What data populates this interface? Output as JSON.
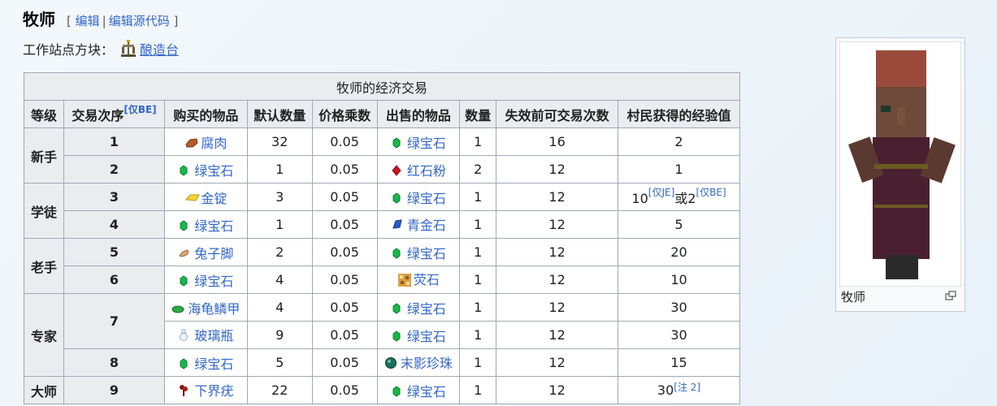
{
  "heading": {
    "title": "牧师",
    "bracket_open": "[",
    "edit": "编辑",
    "separator": "|",
    "edit_source": "编辑源代码",
    "bracket_close": "]"
  },
  "workstation": {
    "label": "工作站点方块：",
    "icon": "brewing-stand-icon",
    "link": "酿造台"
  },
  "table": {
    "caption": "牧师的经济交易",
    "headers": [
      "等级",
      "交易次序",
      "[仅BE]",
      "购买的物品",
      "默认数量",
      "价格乘数",
      "出售的物品",
      "数量",
      "失效前可交易次数",
      "村民获得的经验值"
    ],
    "levels": [
      "新手",
      "学徒",
      "老手",
      "专家",
      "大师"
    ],
    "rows": [
      {
        "order": "1",
        "buy": "腐肉",
        "buy_icon": "rotten-flesh-icon",
        "qty": "32",
        "mult": "0.05",
        "sell": "绿宝石",
        "sell_icon": "emerald-icon",
        "sell_qty": "1",
        "uses": "16",
        "xp": "2"
      },
      {
        "order": "2",
        "buy": "绿宝石",
        "buy_icon": "emerald-icon",
        "qty": "1",
        "mult": "0.05",
        "sell": "红石粉",
        "sell_icon": "redstone-icon",
        "sell_qty": "2",
        "uses": "12",
        "xp": "1"
      },
      {
        "order": "3",
        "buy": "金锭",
        "buy_icon": "gold-ingot-icon",
        "qty": "3",
        "mult": "0.05",
        "sell": "绿宝石",
        "sell_icon": "emerald-icon",
        "sell_qty": "1",
        "uses": "12",
        "xp_a": "10",
        "xp_sup_a": "[仅JE]",
        "xp_or": "或",
        "xp_b": "2",
        "xp_sup_b": "[仅BE]"
      },
      {
        "order": "4",
        "buy": "绿宝石",
        "buy_icon": "emerald-icon",
        "qty": "1",
        "mult": "0.05",
        "sell": "青金石",
        "sell_icon": "lapis-icon",
        "sell_qty": "1",
        "uses": "12",
        "xp": "5"
      },
      {
        "order": "5",
        "buy": "兔子脚",
        "buy_icon": "rabbit-foot-icon",
        "qty": "2",
        "mult": "0.05",
        "sell": "绿宝石",
        "sell_icon": "emerald-icon",
        "sell_qty": "1",
        "uses": "12",
        "xp": "20"
      },
      {
        "order": "6",
        "buy": "绿宝石",
        "buy_icon": "emerald-icon",
        "qty": "4",
        "mult": "0.05",
        "sell": "荧石",
        "sell_icon": "glowstone-icon",
        "sell_qty": "1",
        "uses": "12",
        "xp": "10"
      },
      {
        "order": "7",
        "buy": "海龟鳞甲",
        "buy_icon": "scute-icon",
        "qty": "4",
        "mult": "0.05",
        "sell": "绿宝石",
        "sell_icon": "emerald-icon",
        "sell_qty": "1",
        "uses": "12",
        "xp": "30"
      },
      {
        "buy": "玻璃瓶",
        "buy_icon": "glass-bottle-icon",
        "qty": "9",
        "mult": "0.05",
        "sell": "绿宝石",
        "sell_icon": "emerald-icon",
        "sell_qty": "1",
        "uses": "12",
        "xp": "30"
      },
      {
        "order": "8",
        "buy": "绿宝石",
        "buy_icon": "emerald-icon",
        "qty": "5",
        "mult": "0.05",
        "sell": "末影珍珠",
        "sell_icon": "ender-pearl-icon",
        "sell_qty": "1",
        "uses": "12",
        "xp": "15"
      },
      {
        "order": "9",
        "buy": "下界疣",
        "buy_icon": "nether-wart-icon",
        "qty": "22",
        "mult": "0.05",
        "sell": "绿宝石",
        "sell_icon": "emerald-icon",
        "sell_qty": "1",
        "uses": "12",
        "xp": "30",
        "xp_sup": "[注 2]"
      }
    ]
  },
  "infobox": {
    "caption": "牧师",
    "image": "cleric-villager-render",
    "expand_icon": "expand-icon"
  },
  "colors": {
    "link": "#3366cc",
    "header_bg": "#eaecf0",
    "border": "#a2a9b1"
  }
}
